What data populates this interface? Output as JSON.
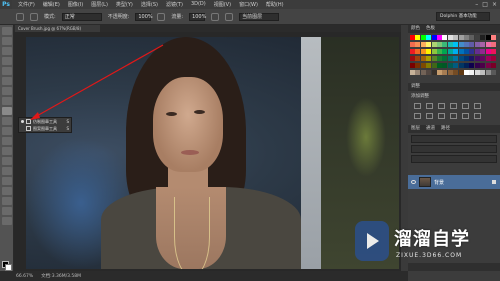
{
  "menubar": {
    "app": "Ps",
    "menus": [
      "文件(F)",
      "编辑(E)",
      "图像(I)",
      "图层(L)",
      "类型(Y)",
      "选择(S)",
      "滤镜(T)",
      "3D(D)",
      "视图(V)",
      "窗口(W)",
      "帮助(H)"
    ],
    "window_controls": [
      "–",
      "□",
      "×"
    ]
  },
  "options": {
    "mode_label": "模式:",
    "mode_value": "正常",
    "opacity_label": "不透明度:",
    "opacity_value": "100%",
    "flow_label": "流量:",
    "flow_value": "100%",
    "sample_value": "当前图层",
    "workspace": "Dolphin 基本功能"
  },
  "document": {
    "tab": "Cover Brush.jpg @ 67%(RGB/8)",
    "zoom": "66.67%",
    "doc_info": "文档:3.36M/3.58M"
  },
  "flyout": {
    "items": [
      {
        "label": "仿制图章工具",
        "key": "S"
      },
      {
        "label": "图案图章工具",
        "key": "S"
      }
    ]
  },
  "panels": {
    "top_tabs": [
      "颜色",
      "色板"
    ],
    "adjustments_tab": "调整",
    "adjustments_label": "添加调整",
    "layers_tabs": [
      "图层",
      "通道",
      "路径"
    ],
    "layer_name": "背景",
    "swatch_colors": [
      "#ff0000",
      "#ffff00",
      "#00ff00",
      "#00ffff",
      "#0000ff",
      "#ff00ff",
      "#ffffff",
      "#e0e0e0",
      "#c0c0c0",
      "#a0a0a0",
      "#808080",
      "#606060",
      "#404040",
      "#202020",
      "#000000",
      "#ff8080",
      "#f26c4f",
      "#f68e55",
      "#fbaf5d",
      "#fff568",
      "#acd372",
      "#7cc576",
      "#3bb878",
      "#1abbb4",
      "#00bff3",
      "#438cca",
      "#5574b9",
      "#605ca8",
      "#855fa8",
      "#a763a8",
      "#f06ea9",
      "#f26d7d",
      "#ed1c24",
      "#f26522",
      "#f7941d",
      "#fff200",
      "#8dc63f",
      "#39b54a",
      "#00a651",
      "#00a99d",
      "#00aeef",
      "#0072bc",
      "#0054a6",
      "#2e3192",
      "#662d91",
      "#92278f",
      "#ec008c",
      "#ed145b",
      "#9e0b0f",
      "#a0410d",
      "#a36209",
      "#aba000",
      "#598527",
      "#1a7b30",
      "#007236",
      "#00746b",
      "#0076a3",
      "#004a80",
      "#003471",
      "#1b1464",
      "#440e62",
      "#630460",
      "#9e005d",
      "#9e0039",
      "#790000",
      "#7b2e00",
      "#7d4900",
      "#827b00",
      "#406618",
      "#005e20",
      "#005826",
      "#005952",
      "#005b7f",
      "#003663",
      "#002157",
      "#0d004c",
      "#32004b",
      "#4b0049",
      "#7b0046",
      "#7a0026",
      "#c7b299",
      "#998675",
      "#736357",
      "#534741",
      "#37302a",
      "#c69c6d",
      "#a67c52",
      "#8c6239",
      "#754c24",
      "#603913",
      "#ffffff",
      "#f2f2f2",
      "#d9d9d9",
      "#bfbfbf",
      "#8c8c8c",
      "#595959"
    ]
  },
  "watermark": {
    "text": "溜溜自学",
    "sub": "ZIXUE.3D66.COM"
  }
}
